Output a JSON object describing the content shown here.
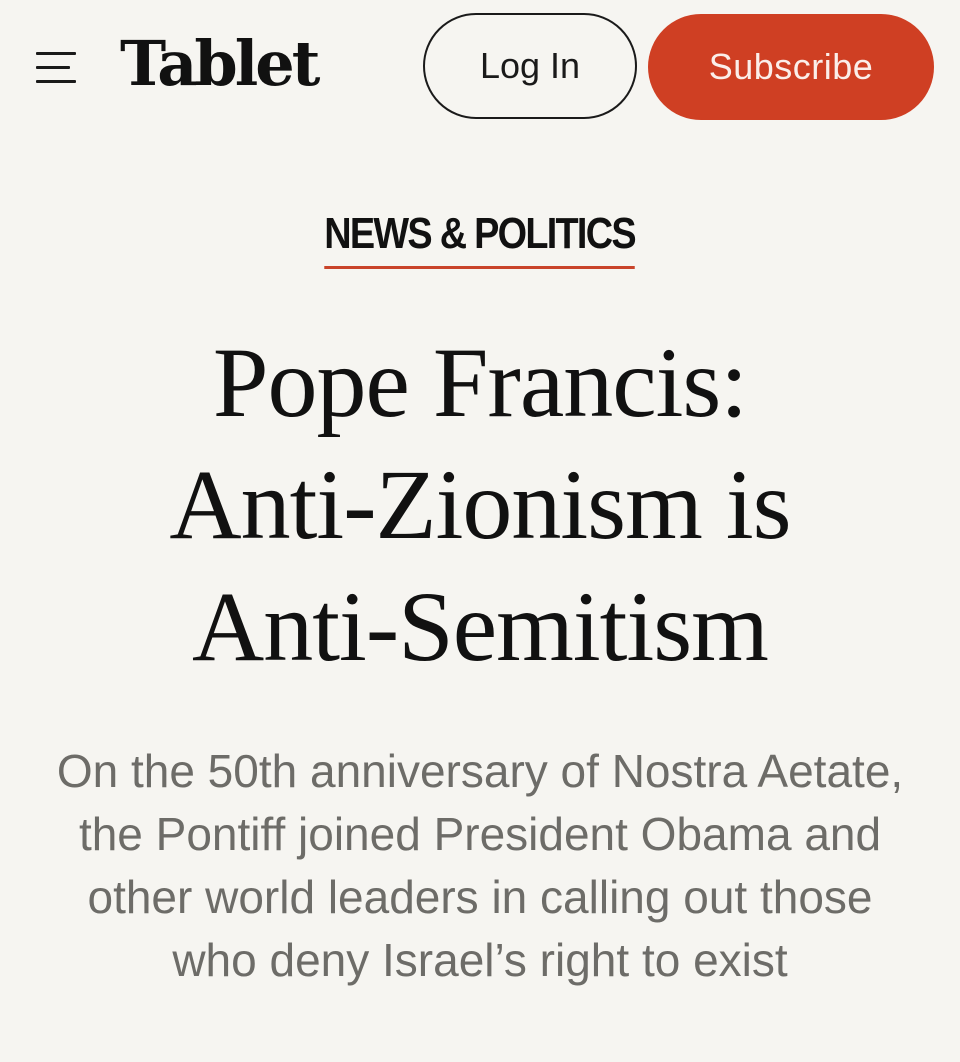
{
  "header": {
    "logo_text": "Tablet",
    "login_label": "Log In",
    "subscribe_label": "Subscribe",
    "menu_icon": "hamburger-menu-icon"
  },
  "article": {
    "category": "NEWS & POLITICS",
    "headline_lines": [
      "Pope Francis:",
      "Anti-Zionism is",
      "Anti-Semitism"
    ],
    "dek": "On the 50th anniversary of Nostra Aetate, the Pontiff joined President Obama and other world leaders in calling out those who deny Israel’s right to exist"
  },
  "colors": {
    "background": "#f6f5f1",
    "subscribe_accent": "#cf3f23",
    "category_underline": "#c9442a",
    "dek_text": "#6d6c68"
  }
}
